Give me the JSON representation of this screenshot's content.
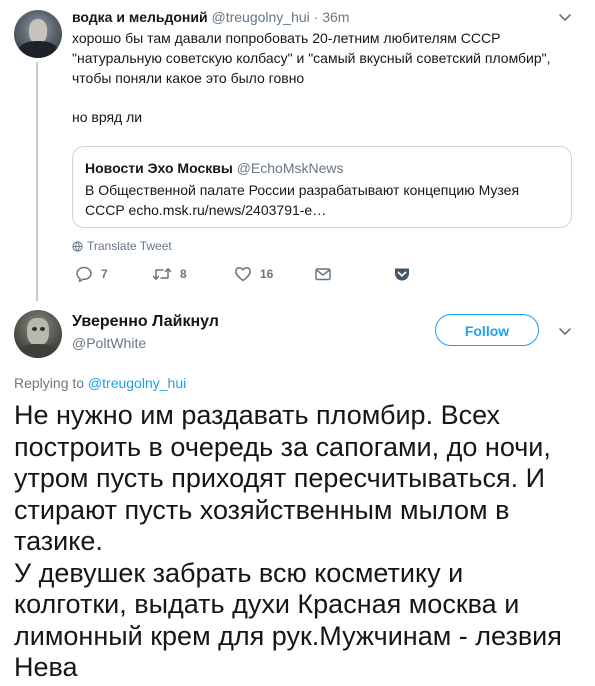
{
  "parent_tweet": {
    "author_name": "водка и мельдоний",
    "handle": "@treugolny_hui",
    "separator": "·",
    "time": "36m",
    "text_lines": [
      "хорошо бы там давали попробовать 20-летним любителям СССР",
      "\"натуральную советскую колбасу\" и \"самый вкусный советский пломбир\",",
      "чтобы поняли какое это было говно"
    ],
    "text_extra": "но вряд ли",
    "quote": {
      "author_name": "Новости Эхо Москвы",
      "handle": "@EchoMskNews",
      "text_lines": [
        "В Общественной палате России разрабатывают концепцию Музея",
        "СССР echo.msk.ru/news/2403791-e…"
      ]
    },
    "translate_label": "Translate Tweet",
    "actions": {
      "reply_count": "7",
      "retweet_count": "8",
      "like_count": "16"
    },
    "icons": [
      "caret-down-icon",
      "globe-icon",
      "reply-icon",
      "retweet-icon",
      "like-icon",
      "message-icon",
      "pocket-icon"
    ]
  },
  "reply_tweet": {
    "author_name": "Уверенно Лайкнул",
    "handle": "@PoltWhite",
    "follow_label": "Follow",
    "replying_prefix": "Replying to",
    "replying_handle": "@treugolny_hui",
    "text_lines": [
      "Не нужно им раздавать пломбир. Всех",
      "построить в очередь за сапогами, до ночи,",
      "утром пусть приходят пересчитываться. И",
      "стирают пусть хозяйственным мылом в",
      "тазике.",
      "У девушек забрать всю косметику и",
      "колготки, выдать духи Красная москва и",
      "лимонный крем для рук.Мужчинам - лезвия",
      "Нева"
    ]
  },
  "colors": {
    "accent": "#1da1f2",
    "muted_text": "#657786",
    "primary_text": "#14171a",
    "border": "#ccd6dd",
    "thread_line": "#c4cfd6",
    "pocket": "#45566b"
  }
}
